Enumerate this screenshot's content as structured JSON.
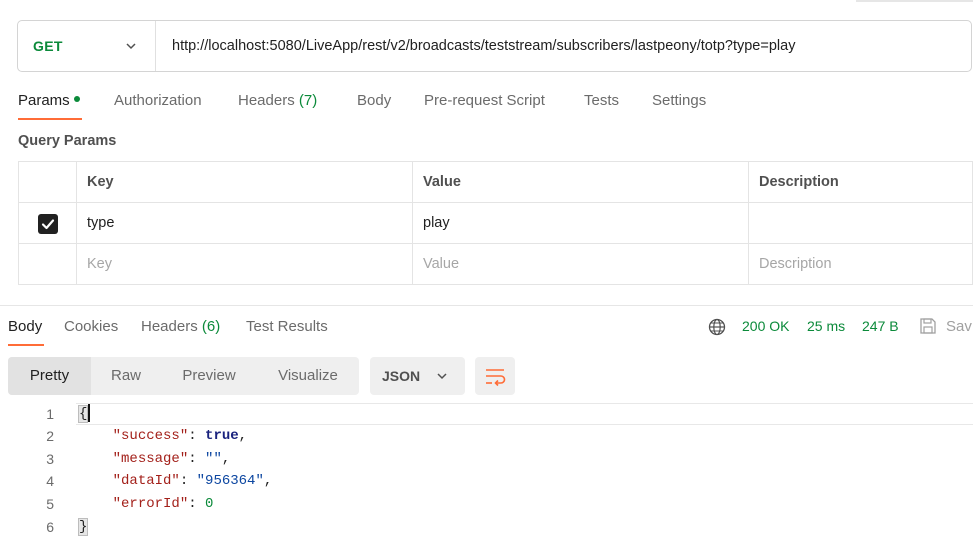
{
  "request": {
    "method": "GET",
    "url": "http://localhost:5080/LiveApp/rest/v2/broadcasts/teststream/subscribers/lastpeony/totp?type=play"
  },
  "request_tabs": {
    "params": "Params",
    "authorization": "Authorization",
    "headers": "Headers",
    "headers_count": "(7)",
    "body": "Body",
    "prerequest": "Pre-request Script",
    "tests": "Tests",
    "settings": "Settings"
  },
  "query_params": {
    "title": "Query Params",
    "columns": [
      "Key",
      "Value",
      "Description"
    ],
    "rows": [
      {
        "checked": true,
        "key": "type",
        "value": "play",
        "description": ""
      }
    ],
    "placeholders": {
      "key": "Key",
      "value": "Value",
      "description": "Description"
    }
  },
  "response_tabs": {
    "body": "Body",
    "cookies": "Cookies",
    "headers": "Headers",
    "headers_count": "(6)",
    "test_results": "Test Results"
  },
  "response_meta": {
    "status": "200 OK",
    "time": "25 ms",
    "size": "247 B",
    "save": "Sav"
  },
  "view_modes": {
    "pretty": "Pretty",
    "raw": "Raw",
    "preview": "Preview",
    "visualize": "Visualize",
    "format": "JSON"
  },
  "response_body": {
    "line_numbers": [
      "1",
      "2",
      "3",
      "4",
      "5",
      "6"
    ],
    "open_brace": "{",
    "close_brace": "}",
    "k1": "\"success\"",
    "v1": "true",
    "k2": "\"message\"",
    "v2": "\"\"",
    "k3": "\"dataId\"",
    "v3": "\"956364\"",
    "k4": "\"errorId\"",
    "v4": "0"
  },
  "colors": {
    "accent": "#ff6c37",
    "success_green": "#0b8a3a"
  }
}
